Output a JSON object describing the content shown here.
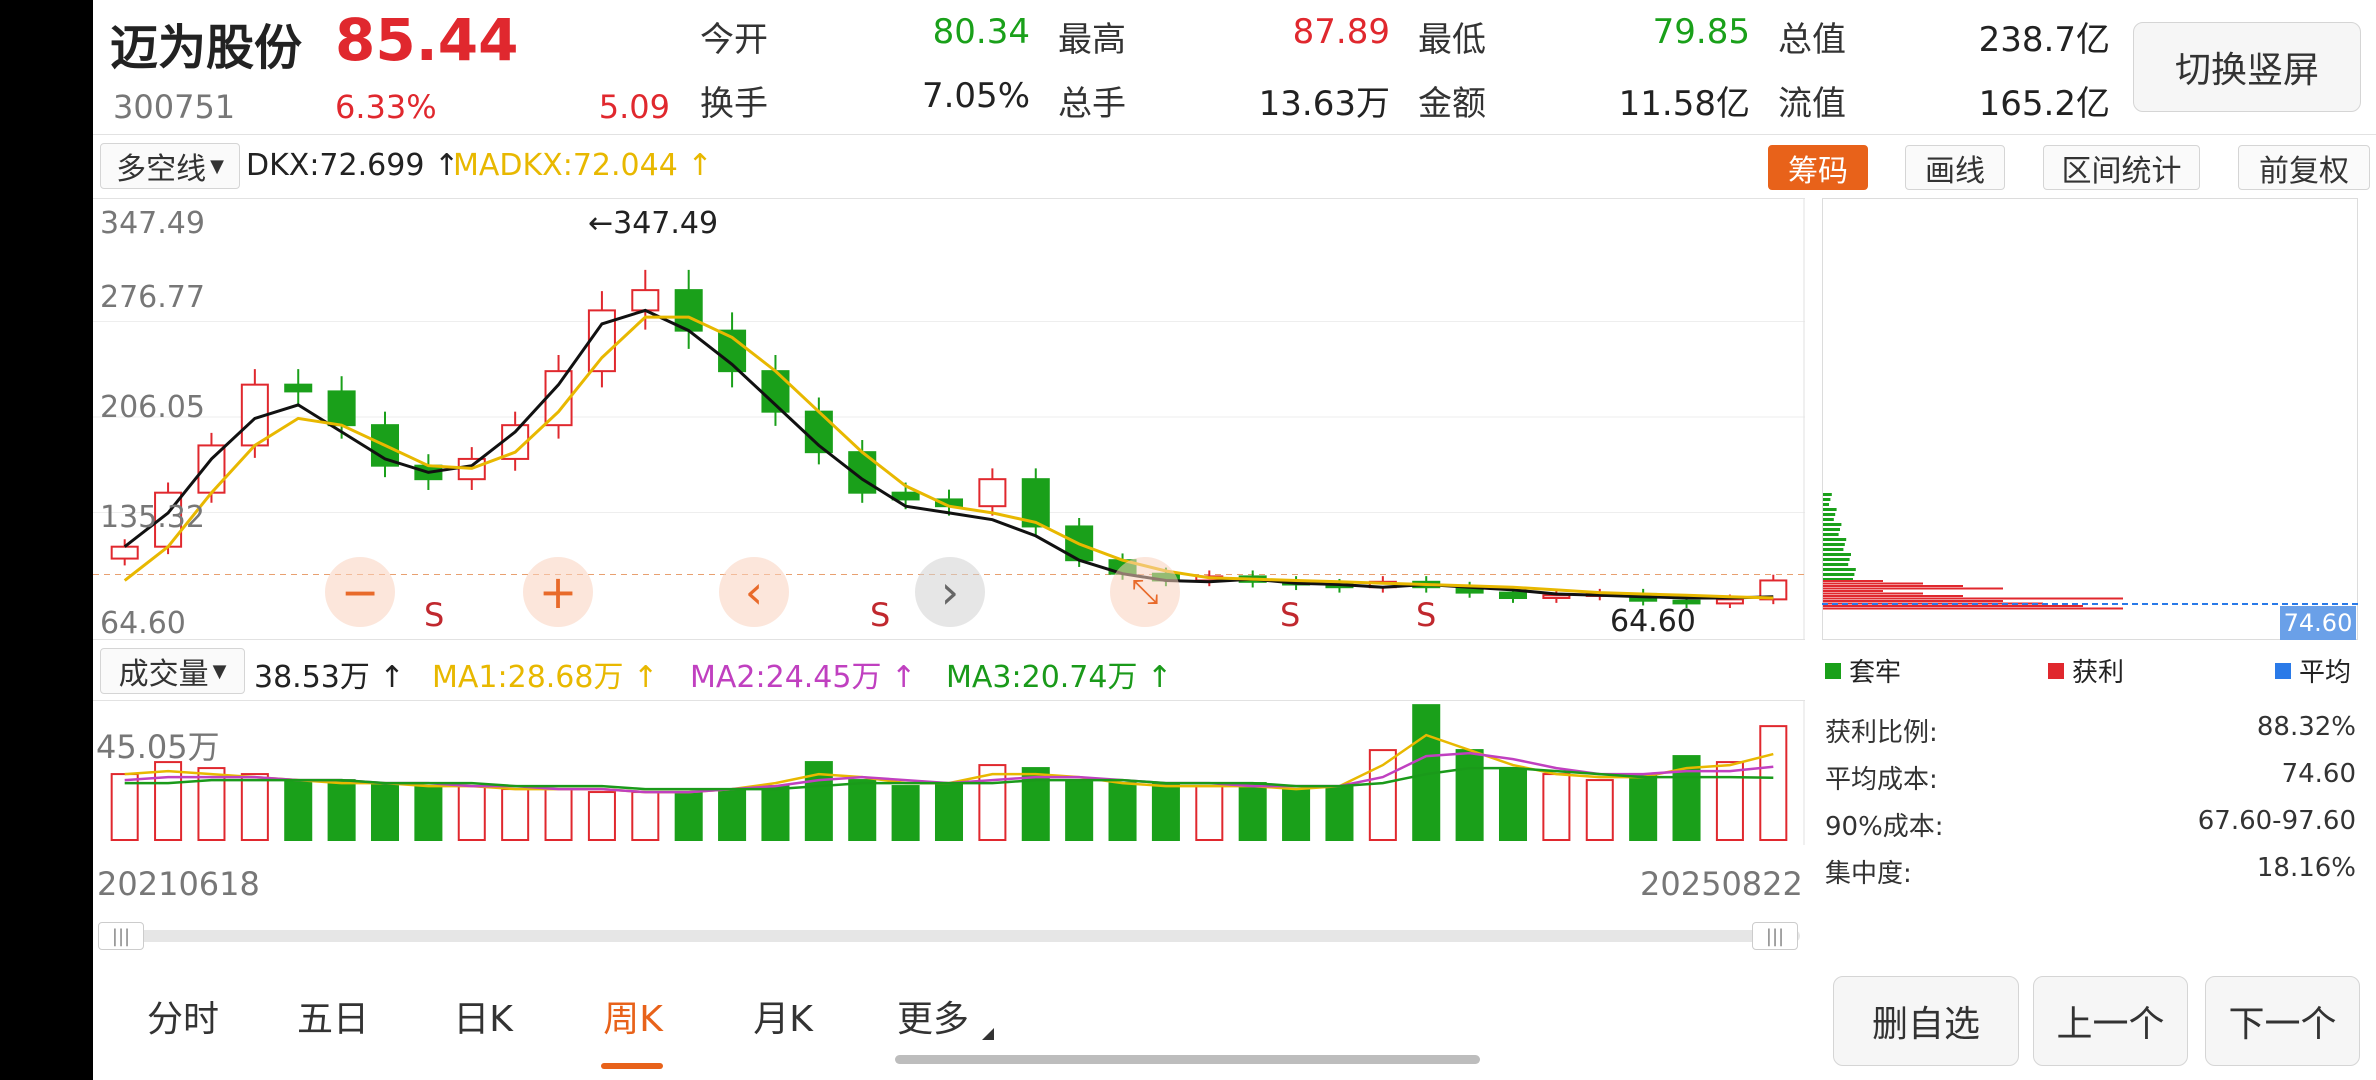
{
  "stock": {
    "name": "迈为股份",
    "price": "85.44",
    "code": "300751",
    "change_pct": "6.33%",
    "change": "5.09"
  },
  "quote": [
    {
      "label": "今开",
      "value": "80.34",
      "color": "green"
    },
    {
      "label": "最高",
      "value": "87.89",
      "color": "red"
    },
    {
      "label": "最低",
      "value": "79.85",
      "color": "green"
    },
    {
      "label": "总值",
      "value": "238.7亿",
      "color": "black"
    },
    {
      "label": "换手",
      "value": "7.05%",
      "color": "black"
    },
    {
      "label": "总手",
      "value": "13.63万",
      "color": "black"
    },
    {
      "label": "金额",
      "value": "11.58亿",
      "color": "black"
    },
    {
      "label": "流值",
      "value": "165.2亿",
      "color": "black"
    }
  ],
  "switch_button": "切换竖屏",
  "indicator": {
    "selector": "多空线",
    "dkx": "DKX:72.699",
    "madkx": "MADKX:72.044"
  },
  "tools": {
    "chips": "筹码",
    "draw": "画线",
    "range_stats": "区间统计",
    "adjust": "前复权"
  },
  "price_axis": {
    "labels": [
      "347.49",
      "276.77",
      "206.05",
      "135.32",
      "64.60"
    ],
    "high_marker": "←347.49",
    "low_marker": "64.60",
    "current_price_tag": "74.60"
  },
  "signals": [
    "S",
    "S",
    "S",
    "S"
  ],
  "chart_controls": {
    "zoom_out": "−",
    "zoom_in": "+",
    "prev": "‹",
    "next": "›"
  },
  "volume": {
    "selector": "成交量",
    "value": "38.53万",
    "ma1": "MA1:28.68万",
    "ma2": "MA2:24.45万",
    "ma3": "MA3:20.74万",
    "max_label": "45.05万"
  },
  "dates": {
    "start": "20210618",
    "end": "20250822"
  },
  "chip_legend": {
    "trapped": "套牢",
    "profit": "获利",
    "average": "平均"
  },
  "chip_stats": [
    {
      "label": "获利比例:",
      "value": "88.32%"
    },
    {
      "label": "平均成本:",
      "value": "74.60"
    },
    {
      "label": "90%成本:",
      "value": "67.60-97.60"
    },
    {
      "label": "集中度:",
      "value": "18.16%"
    }
  ],
  "tabs": [
    "分时",
    "五日",
    "日K",
    "周K",
    "月K",
    "更多"
  ],
  "active_tab": "周K",
  "bottom_buttons": {
    "remove_watch": "删自选",
    "prev_stock": "上一个",
    "next_stock": "下一个"
  },
  "colors": {
    "up": "#e0282e",
    "down": "#1aa01a",
    "accent": "#e8621a",
    "dkx": "#111111",
    "madkx": "#e8b800",
    "ma2": "#c040c0",
    "ma3": "#1a9a1a"
  },
  "chart_data": [
    {
      "type": "candlestick",
      "title": "",
      "series": [
        {
          "name": "DKX",
          "values": [
            110,
            135,
            175,
            205,
            215,
            195,
            175,
            165,
            170,
            195,
            230,
            275,
            285,
            270,
            245,
            215,
            185,
            160,
            140,
            135,
            130,
            118,
            100,
            90,
            85,
            84,
            86,
            83,
            82,
            80,
            82,
            80,
            78,
            75,
            74,
            73,
            72,
            72,
            73
          ]
        },
        {
          "name": "MADKX",
          "values": [
            85,
            110,
            150,
            185,
            205,
            200,
            185,
            170,
            168,
            180,
            210,
            250,
            280,
            280,
            265,
            240,
            210,
            180,
            155,
            140,
            135,
            128,
            112,
            100,
            92,
            87,
            86,
            85,
            84,
            83,
            82,
            81,
            80,
            78,
            76,
            75,
            74,
            73,
            72
          ]
        }
      ],
      "close": [
        110,
        150,
        185,
        230,
        225,
        200,
        170,
        160,
        175,
        200,
        240,
        285,
        300,
        270,
        240,
        210,
        180,
        150,
        145,
        140,
        160,
        125,
        100,
        90,
        85,
        88,
        84,
        82,
        80,
        84,
        80,
        76,
        72,
        74,
        75,
        70,
        68,
        71,
        85
      ],
      "ylim": [
        64.6,
        347.49
      ],
      "y_ticks": [
        "347.49",
        "276.77",
        "206.05",
        "135.32",
        "64.60"
      ],
      "x_range": [
        "20210618",
        "20250822"
      ]
    },
    {
      "type": "bar",
      "title": "",
      "series": [
        {
          "name": "成交量",
          "values": [
            22,
            26,
            24,
            22,
            20,
            20,
            19,
            18,
            18,
            17,
            17,
            16,
            16,
            16,
            17,
            18,
            26,
            20,
            18,
            19,
            25,
            24,
            20,
            19,
            19,
            18,
            19,
            17,
            18,
            30,
            45,
            30,
            24,
            22,
            20,
            22,
            28,
            26,
            38
          ]
        },
        {
          "name": "MA1",
          "values": [
            22,
            23,
            22,
            21,
            20,
            19,
            19,
            18,
            18,
            17,
            17,
            17,
            16,
            16,
            17,
            19,
            22,
            21,
            19,
            19,
            22,
            22,
            21,
            19,
            18,
            18,
            18,
            17,
            18,
            25,
            35,
            30,
            25,
            22,
            21,
            21,
            24,
            25,
            28.68
          ]
        },
        {
          "name": "MA2",
          "values": [
            20,
            21,
            21,
            21,
            20,
            20,
            19,
            19,
            18,
            18,
            17,
            17,
            16,
            16,
            17,
            18,
            20,
            21,
            20,
            19,
            20,
            21,
            21,
            20,
            19,
            19,
            18,
            18,
            18,
            21,
            28,
            29,
            27,
            24,
            22,
            22,
            23,
            23,
            24.45
          ]
        },
        {
          "name": "MA3",
          "values": [
            19,
            19,
            20,
            20,
            20,
            20,
            19,
            19,
            19,
            18,
            18,
            18,
            17,
            17,
            17,
            17,
            18,
            19,
            19,
            19,
            19,
            20,
            20,
            20,
            19,
            19,
            19,
            18,
            18,
            19,
            22,
            24,
            24,
            23,
            22,
            21,
            21,
            21,
            20.74
          ]
        }
      ],
      "ylim": [
        0,
        45.05
      ],
      "y_ticks": [
        "45.05万"
      ]
    }
  ]
}
